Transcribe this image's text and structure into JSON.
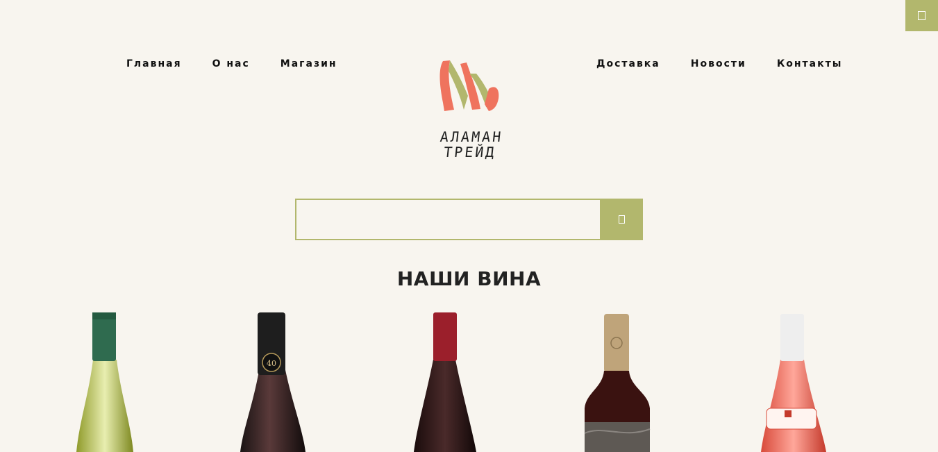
{
  "header": {
    "nav_left": [
      "Главная",
      "О нас",
      "Магазин"
    ],
    "nav_right": [
      "Доставка",
      "Новости",
      "Контакты"
    ],
    "logo_text": "АЛАМАН ТРЕЙД"
  },
  "search": {
    "value": "",
    "button_icon": "search-icon"
  },
  "corner_button_icon": "book-icon",
  "section": {
    "title": "НАШИ ВИНА"
  },
  "products": [
    {
      "name": "white-wine-bottle",
      "cap_color": "#2f6b4f"
    },
    {
      "name": "red-wine-bottle-40",
      "cap_color": "#1e1e1e",
      "label": "40"
    },
    {
      "name": "red-wine-bottle-red-cap",
      "cap_color": "#9b1f2b"
    },
    {
      "name": "red-wine-bottle-gold-cap",
      "cap_color": "#bfa47a"
    },
    {
      "name": "rose-wine-bottle",
      "cap_color": "#eeeeee"
    }
  ],
  "colors": {
    "accent": "#b2b76d",
    "logo_coral": "#ef735e",
    "logo_green": "#b2b76d",
    "background": "#f8f5ef"
  }
}
